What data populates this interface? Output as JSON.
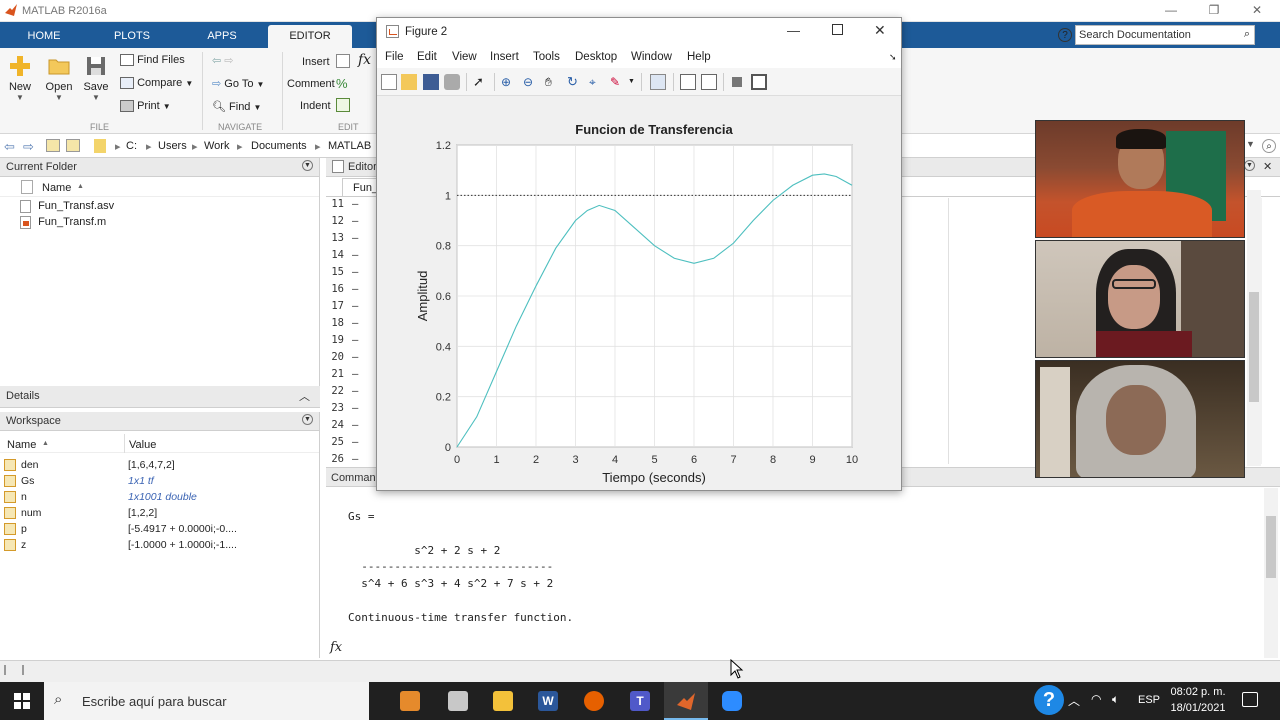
{
  "window": {
    "title": "MATLAB R2016a"
  },
  "tabs": [
    "HOME",
    "PLOTS",
    "APPS",
    "EDITOR"
  ],
  "ribbon": {
    "new": "New",
    "open": "Open",
    "save": "Save",
    "find_files": "Find Files",
    "compare": "Compare",
    "print": "Print",
    "go_to": "Go To",
    "find": "Find",
    "insert": "Insert",
    "comment": "Comment",
    "indent": "Indent",
    "group_file": "FILE",
    "group_navigate": "NAVIGATE",
    "group_edit": "EDIT",
    "search_placeholder": "Search Documentation"
  },
  "address": {
    "parts": [
      "C:",
      "Users",
      "Work",
      "Documents",
      "MATLAB"
    ]
  },
  "current_folder": {
    "title": "Current Folder",
    "col_name": "Name",
    "files": [
      "Fun_Transf.asv",
      "Fun_Transf.m"
    ]
  },
  "details": {
    "title": "Details"
  },
  "workspace": {
    "title": "Workspace",
    "col_name": "Name",
    "col_value": "Value",
    "vars": [
      {
        "name": "den",
        "value": "[1,6,4,7,2]",
        "italic": false
      },
      {
        "name": "Gs",
        "value": "1x1 tf",
        "italic": true
      },
      {
        "name": "n",
        "value": "1x1001 double",
        "italic": true
      },
      {
        "name": "num",
        "value": "[1,2,2]",
        "italic": false
      },
      {
        "name": "p",
        "value": "[-5.4917 + 0.0000i;-0....",
        "italic": false
      },
      {
        "name": "z",
        "value": "[-1.0000 + 1.0000i;-1....",
        "italic": false
      }
    ]
  },
  "editor": {
    "title": "Editor",
    "tab": "Fun_",
    "line_numbers": [
      "11",
      "12",
      "13",
      "14",
      "15",
      "16",
      "17",
      "18",
      "19",
      "20",
      "21",
      "22",
      "23",
      "24",
      "25",
      "26"
    ]
  },
  "command_window": {
    "title": "Command",
    "lines": [
      "Gs =",
      "",
      "          s^2 + 2 s + 2",
      "  -----------------------------",
      "  s^4 + 6 s^3 + 4 s^2 + 7 s + 2",
      "",
      "Continuous-time transfer function."
    ],
    "prompt": "fx"
  },
  "figure": {
    "title": "Figure 2",
    "menu": [
      "File",
      "Edit",
      "View",
      "Insert",
      "Tools",
      "Desktop",
      "Window",
      "Help"
    ]
  },
  "chart_data": {
    "type": "line",
    "title": "Funcion de Transferencia",
    "xlabel": "Tiempo (seconds)",
    "ylabel": "Amplitud",
    "xlim": [
      0,
      10
    ],
    "ylim": [
      0,
      1.2
    ],
    "xticks": [
      0,
      1,
      2,
      3,
      4,
      5,
      6,
      7,
      8,
      9,
      10
    ],
    "yticks": [
      0,
      0.2,
      0.4,
      0.6,
      0.8,
      1,
      1.2
    ],
    "grid": true,
    "reference_line": 1,
    "series": [
      {
        "color": "#4dbfbf",
        "x": [
          0,
          0.5,
          1,
          1.5,
          2,
          2.5,
          3,
          3.3,
          3.6,
          4,
          4.5,
          5,
          5.5,
          6,
          6.5,
          7,
          7.5,
          8,
          8.5,
          9,
          9.3,
          9.6,
          10
        ],
        "y": [
          0,
          0.12,
          0.3,
          0.48,
          0.64,
          0.79,
          0.9,
          0.94,
          0.96,
          0.94,
          0.87,
          0.8,
          0.75,
          0.73,
          0.75,
          0.81,
          0.9,
          0.98,
          1.04,
          1.08,
          1.085,
          1.075,
          1.04
        ]
      }
    ]
  },
  "taskbar": {
    "search_placeholder": "Escribe aquí para buscar",
    "lang": "ESP",
    "time": "08:02 p. m.",
    "date": "18/01/2021"
  }
}
